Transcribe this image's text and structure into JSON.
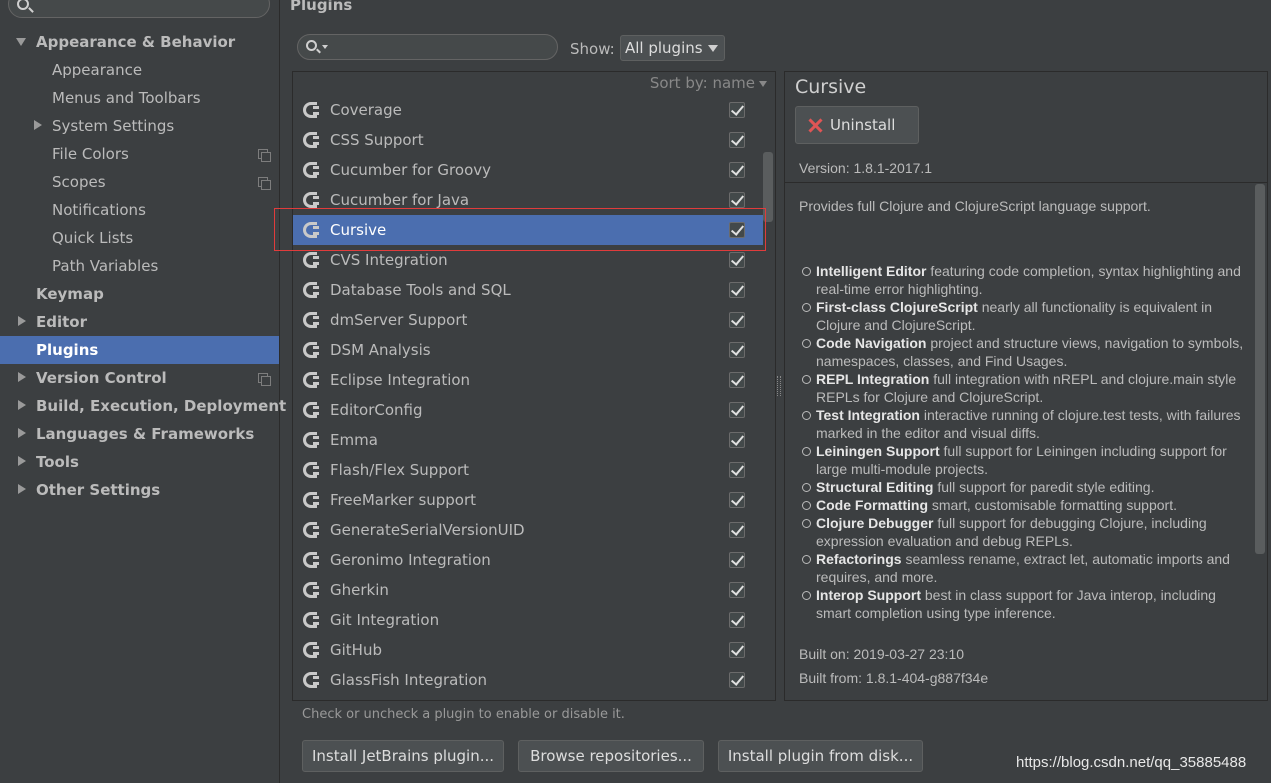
{
  "sidebar": {
    "search_placeholder": "",
    "items": [
      {
        "label": "Appearance & Behavior",
        "level": 0,
        "bold": true,
        "arrow": "down"
      },
      {
        "label": "Appearance",
        "level": 1
      },
      {
        "label": "Menus and Toolbars",
        "level": 1
      },
      {
        "label": "System Settings",
        "level": 1,
        "arrow": "right"
      },
      {
        "label": "File Colors",
        "level": 1,
        "copy_icon": true
      },
      {
        "label": "Scopes",
        "level": 1,
        "copy_icon": true
      },
      {
        "label": "Notifications",
        "level": 1
      },
      {
        "label": "Quick Lists",
        "level": 1
      },
      {
        "label": "Path Variables",
        "level": 1
      },
      {
        "label": "Keymap",
        "level": 0,
        "bold": true
      },
      {
        "label": "Editor",
        "level": 0,
        "bold": true,
        "arrow": "right"
      },
      {
        "label": "Plugins",
        "level": 0,
        "bold": true,
        "selected": true
      },
      {
        "label": "Version Control",
        "level": 0,
        "bold": true,
        "arrow": "right",
        "copy_icon": true
      },
      {
        "label": "Build, Execution, Deployment",
        "level": 0,
        "bold": true,
        "arrow": "right"
      },
      {
        "label": "Languages & Frameworks",
        "level": 0,
        "bold": true,
        "arrow": "right"
      },
      {
        "label": "Tools",
        "level": 0,
        "bold": true,
        "arrow": "right"
      },
      {
        "label": "Other Settings",
        "level": 0,
        "bold": true,
        "arrow": "right"
      }
    ]
  },
  "main": {
    "title": "Plugins",
    "show_label": "Show:",
    "show_value": "All plugins",
    "sort_label": "Sort by: name",
    "plugins": [
      {
        "name": "Coverage",
        "checked": true
      },
      {
        "name": "CSS Support",
        "checked": true
      },
      {
        "name": "Cucumber for Groovy",
        "checked": true
      },
      {
        "name": "Cucumber for Java",
        "checked": true
      },
      {
        "name": "Cursive",
        "checked": true,
        "selected": true
      },
      {
        "name": "CVS Integration",
        "checked": true
      },
      {
        "name": "Database Tools and SQL",
        "checked": true
      },
      {
        "name": "dmServer Support",
        "checked": true
      },
      {
        "name": "DSM Analysis",
        "checked": true
      },
      {
        "name": "Eclipse Integration",
        "checked": true
      },
      {
        "name": "EditorConfig",
        "checked": true
      },
      {
        "name": "Emma",
        "checked": true
      },
      {
        "name": "Flash/Flex Support",
        "checked": true
      },
      {
        "name": "FreeMarker support",
        "checked": true
      },
      {
        "name": "GenerateSerialVersionUID",
        "checked": true
      },
      {
        "name": "Geronimo Integration",
        "checked": true
      },
      {
        "name": "Gherkin",
        "checked": true
      },
      {
        "name": "Git Integration",
        "checked": true
      },
      {
        "name": "GitHub",
        "checked": true
      },
      {
        "name": "GlassFish Integration",
        "checked": true
      }
    ],
    "hint": "Check or uncheck a plugin to enable or disable it.",
    "buttons": {
      "install_jetbrains": "Install JetBrains plugin...",
      "browse": "Browse repositories...",
      "install_disk": "Install plugin from disk..."
    }
  },
  "details": {
    "title": "Cursive",
    "uninstall_label": "Uninstall",
    "version": "Version: 1.8.1-2017.1",
    "description": "Provides full Clojure and ClojureScript language support.",
    "features": [
      {
        "title": "Intelligent Editor",
        "text": " featuring code completion, syntax highlighting and real-time error highlighting."
      },
      {
        "title": "First-class ClojureScript",
        "text": " nearly all functionality is equivalent in Clojure and ClojureScript."
      },
      {
        "title": "Code Navigation",
        "text": " project and structure views, navigation to symbols, namespaces, classes, and Find Usages."
      },
      {
        "title": "REPL Integration",
        "text": " full integration with nREPL and clojure.main style REPLs for Clojure and ClojureScript."
      },
      {
        "title": "Test Integration",
        "text": " interactive running of clojure.test tests, with failures marked in the editor and visual diffs."
      },
      {
        "title": "Leiningen Support",
        "text": " full support for Leiningen including support for large multi-module projects."
      },
      {
        "title": "Structural Editing",
        "text": " full support for paredit style editing."
      },
      {
        "title": "Code Formatting",
        "text": " smart, customisable formatting support."
      },
      {
        "title": "Clojure Debugger",
        "text": " full support for debugging Clojure, including expression evaluation and debug REPLs."
      },
      {
        "title": "Refactorings",
        "text": " seamless rename, extract let, automatic imports and requires, and more."
      },
      {
        "title": "Interop Support",
        "text": " best in class support for Java interop, including smart completion using type inference."
      }
    ],
    "built_on": "Built on: 2019-03-27 23:10",
    "built_from": "Built from: 1.8.1-404-g887f34e"
  },
  "watermark": "https://blog.csdn.net/qq_35885488",
  "colors": {
    "background": "#3c3f41",
    "selection": "#4b6eaf",
    "highlight_border": "#e03c3c"
  }
}
